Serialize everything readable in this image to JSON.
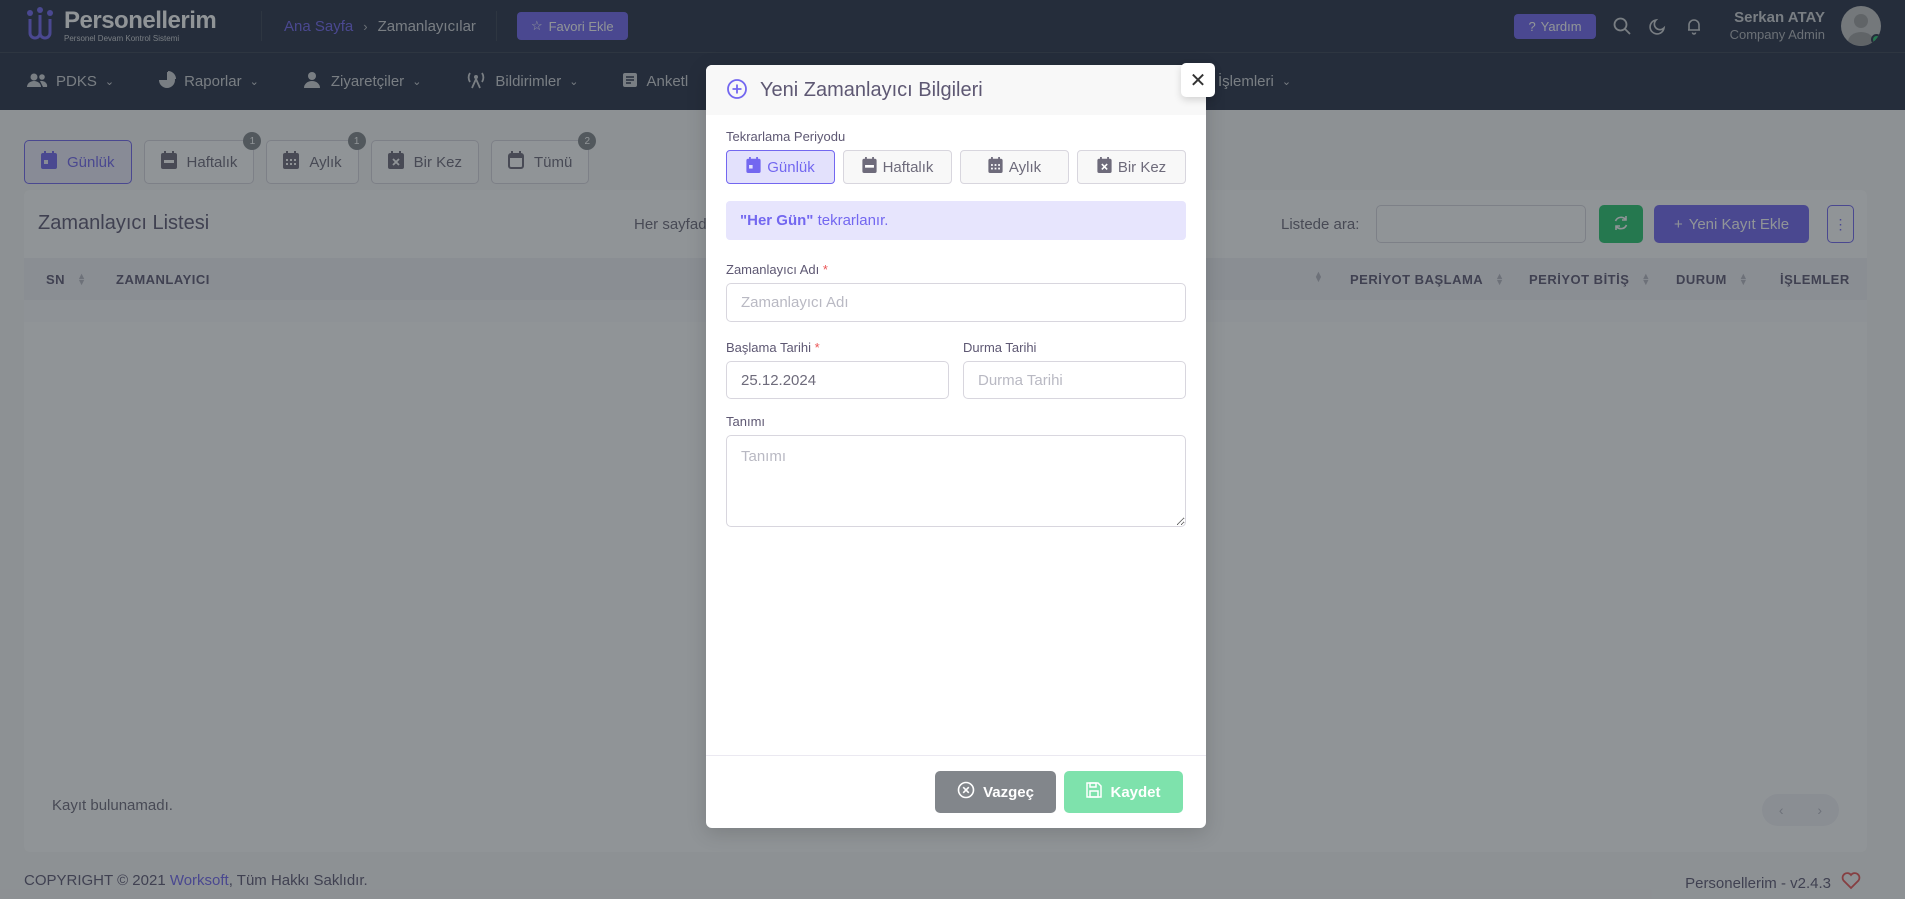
{
  "header": {
    "logo_title": "Personellerim",
    "logo_subtitle": "Personel Devam Kontrol Sistemi",
    "breadcrumb_home": "Ana Sayfa",
    "breadcrumb_current": "Zamanlayıcılar",
    "favorite_label": "Favori Ekle",
    "help_label": "Yardım",
    "user_name": "Serkan ATAY",
    "user_role": "Company Admin"
  },
  "menu": {
    "items": [
      {
        "label": "PDKS",
        "icon": "users-icon"
      },
      {
        "label": "Raporlar",
        "icon": "pie-chart-icon"
      },
      {
        "label": "Ziyaretçiler",
        "icon": "user-icon"
      },
      {
        "label": "Bildirimler",
        "icon": "broadcast-icon"
      },
      {
        "label": "Anketl",
        "icon": "clipboard-icon"
      }
    ],
    "partial_right": "İşlemleri"
  },
  "page_tabs": [
    {
      "label": "Günlük",
      "badge": "",
      "active": true,
      "icon": "calendar-day-icon"
    },
    {
      "label": "Haftalık",
      "badge": "1",
      "active": false,
      "icon": "calendar-week-icon"
    },
    {
      "label": "Aylık",
      "badge": "1",
      "active": false,
      "icon": "calendar-month-icon"
    },
    {
      "label": "Bir Kez",
      "badge": "",
      "active": false,
      "icon": "calendar-x-icon"
    },
    {
      "label": "Tümü",
      "badge": "2",
      "active": false,
      "icon": "calendar-icon"
    }
  ],
  "list": {
    "title": "Zamanlayıcı Listesi",
    "per_page_label": "Her sayfad",
    "search_label": "Listede ara:",
    "add_label": "Yeni Kayıt Ekle",
    "columns": [
      "SN",
      "ZAMANLAYICI",
      "PERİYOT BAŞLAMA",
      "PERİYOT BİTİŞ",
      "DURUM",
      "İŞLEMLER"
    ],
    "empty_text": "Kayıt bulunamadı."
  },
  "footer": {
    "copyright_prefix": "COPYRIGHT © 2021 ",
    "company": "Worksoft",
    "copyright_suffix": ", Tüm Hakkı Saklıdır.",
    "version": "Personellerim - v2.4.3"
  },
  "modal": {
    "title": "Yeni Zamanlayıcı Bilgileri",
    "period_label": "Tekrarlama Periyodu",
    "periods": [
      "Günlük",
      "Haftalık",
      "Aylık",
      "Bir Kez"
    ],
    "selected_period": "Günlük",
    "info_quoted": "\"Her Gün\"",
    "info_rest": " tekrarlanır.",
    "name_label": "Zamanlayıcı Adı",
    "name_placeholder": "Zamanlayıcı Adı",
    "name_value": "",
    "start_label": "Başlama Tarihi",
    "start_value": "25.12.2024",
    "end_label": "Durma Tarihi",
    "end_placeholder": "Durma Tarihi",
    "desc_label": "Tanımı",
    "desc_placeholder": "Tanımı",
    "required_mark": "*",
    "cancel_label": "Vazgeç",
    "save_label": "Kaydet"
  },
  "colors": {
    "primary": "#7367f0",
    "success": "#28c76f",
    "navbar": "#283046",
    "secondary": "#82868b"
  }
}
